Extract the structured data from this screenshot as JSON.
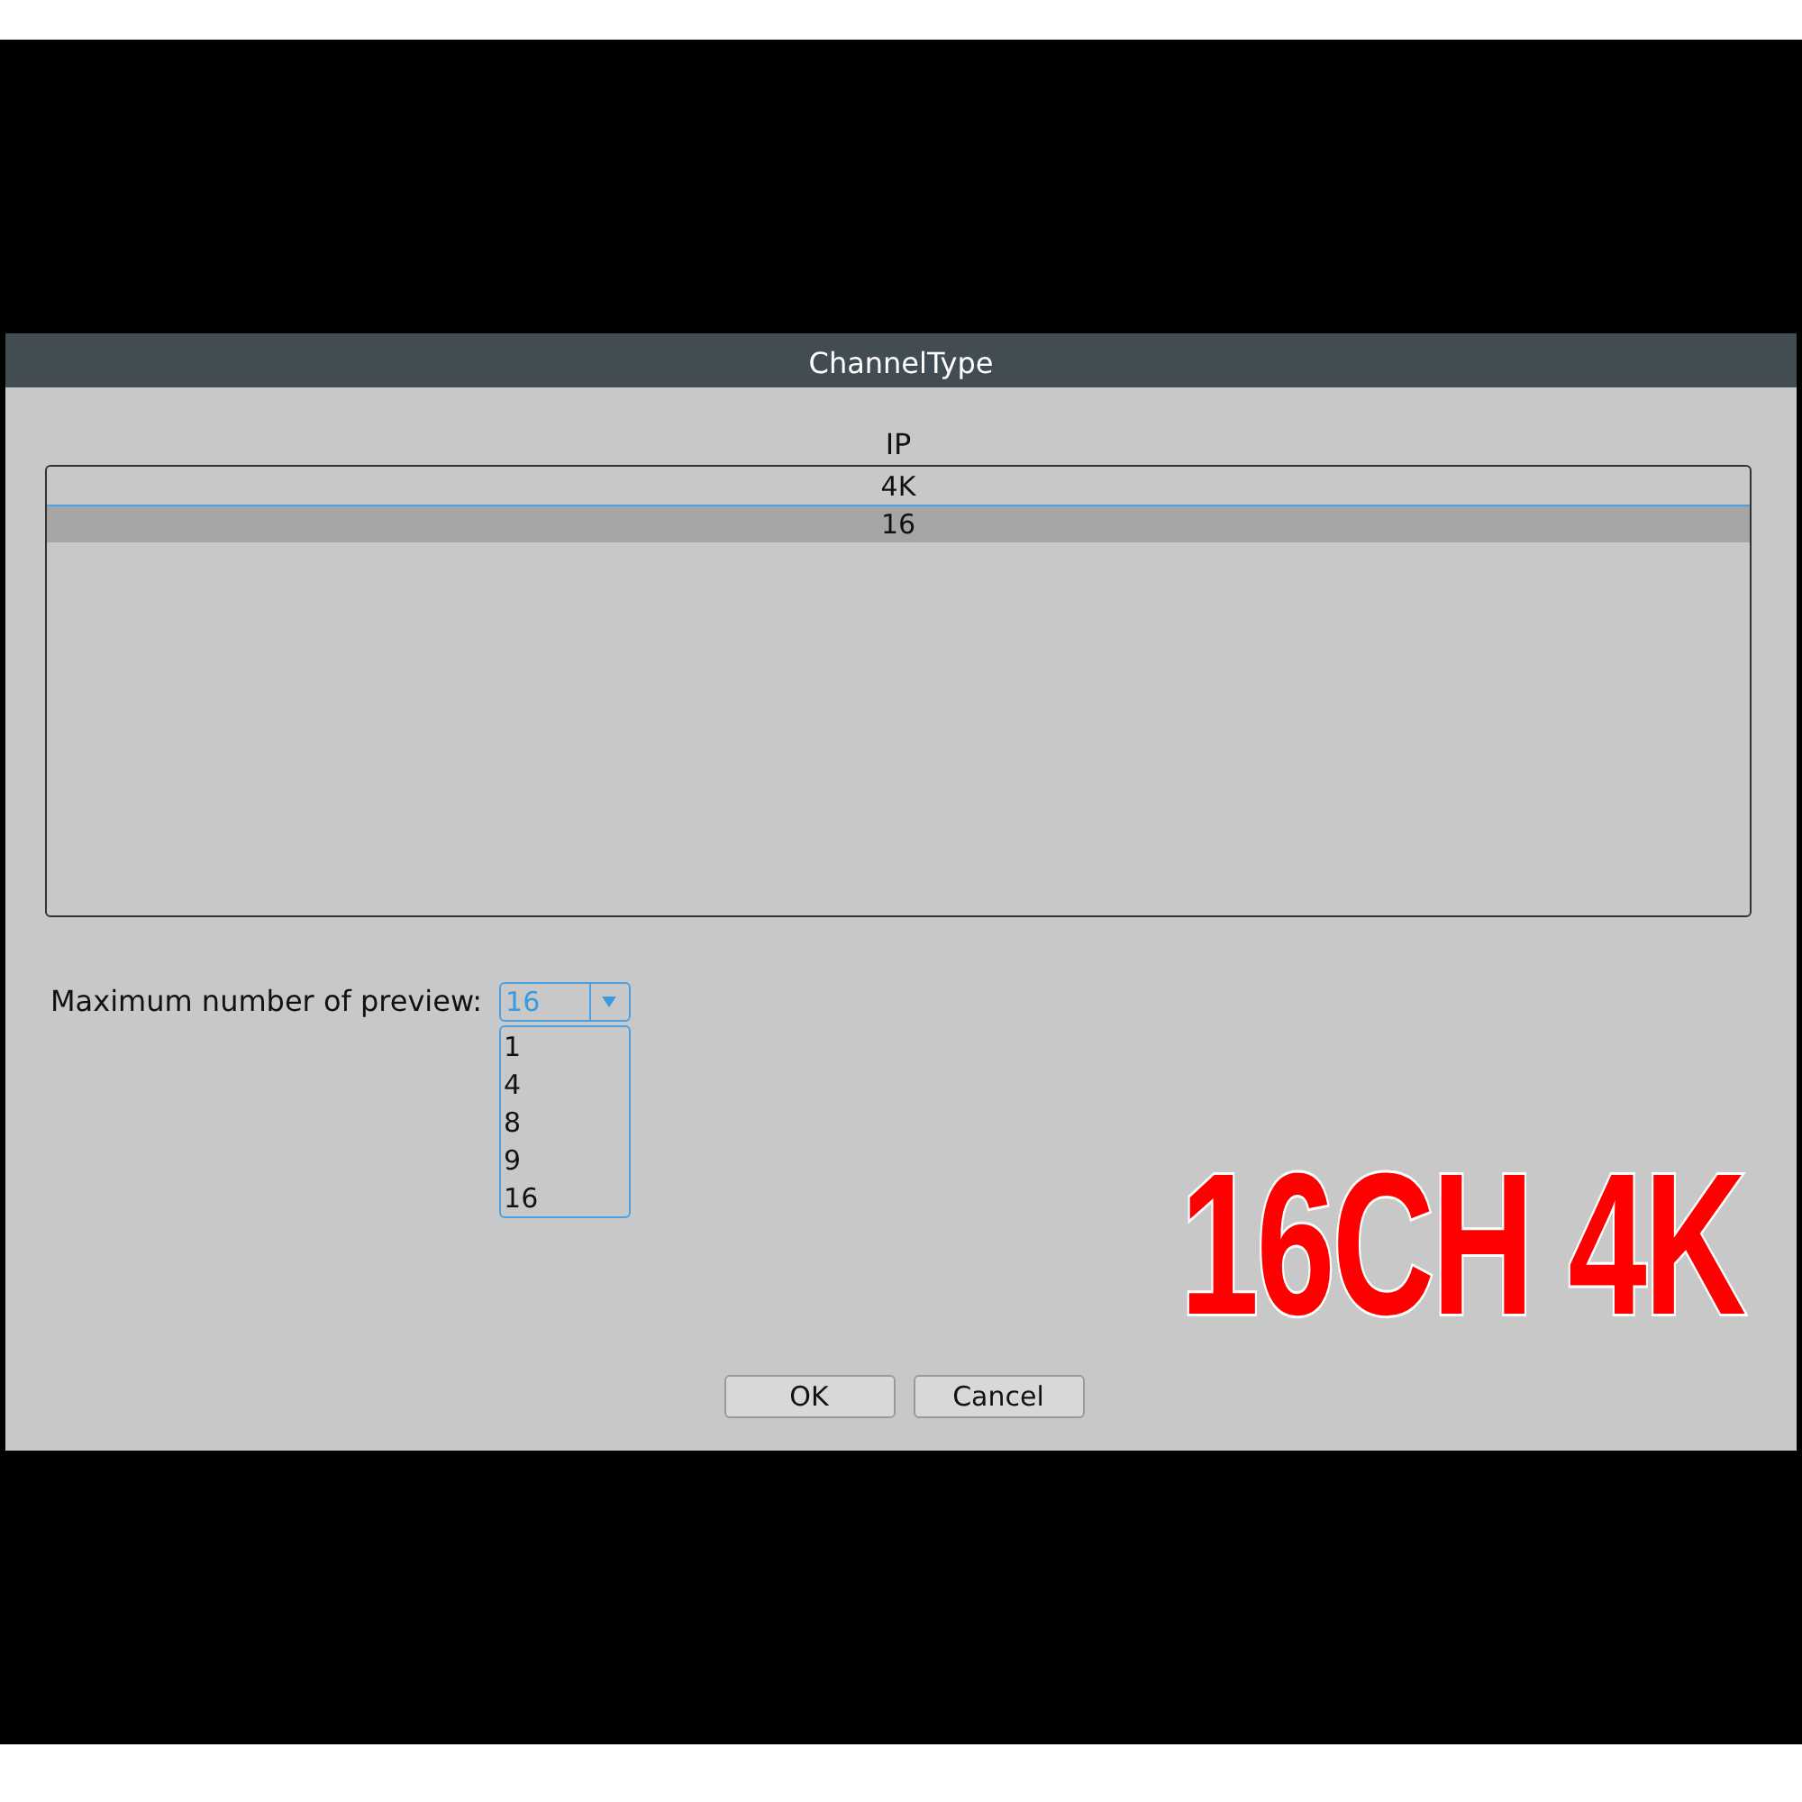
{
  "dialog": {
    "title": "ChannelType"
  },
  "channel_list": {
    "column": "IP",
    "rows": [
      {
        "label": "4K",
        "selected": false
      },
      {
        "label": "16",
        "selected": true
      }
    ]
  },
  "preview": {
    "label": "Maximum number of preview:",
    "value": "16",
    "expanded": true,
    "options": [
      "1",
      "4",
      "8",
      "9",
      "16"
    ]
  },
  "buttons": [
    "OK",
    "Cancel"
  ],
  "overlay": {
    "text": "16CH 4K"
  }
}
